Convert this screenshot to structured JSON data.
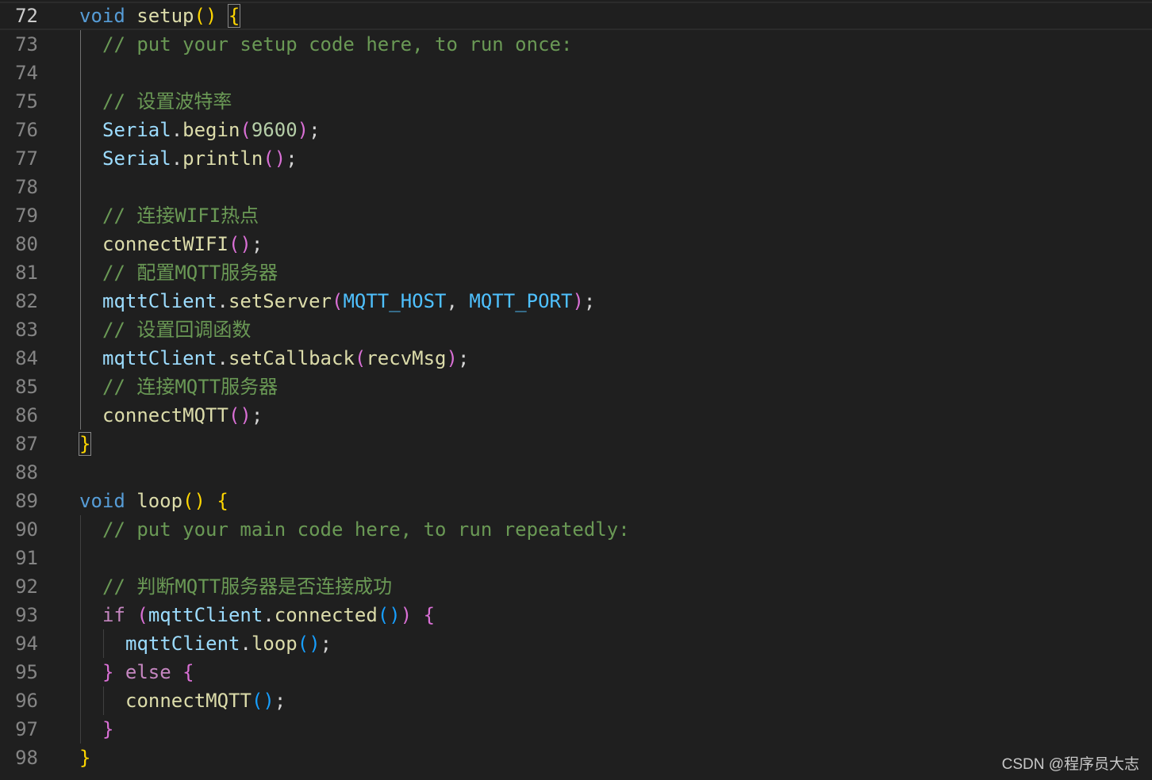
{
  "editor": {
    "language": "cpp",
    "theme_colors": {
      "background": "#1f1f1f",
      "line_number": "#858585",
      "keyword": "#569cd6",
      "control": "#c586c0",
      "function": "#dcdcaa",
      "variable": "#9cdcfe",
      "constant": "#4fc1ff",
      "number": "#b5cea8",
      "comment": "#6a9955",
      "bracket_level_1": "#ffd700",
      "bracket_level_2": "#da70d6",
      "bracket_level_3": "#179fff"
    },
    "current_line": 72,
    "lines": [
      {
        "n": "72",
        "indent": 0,
        "tokens": [
          [
            "kw",
            "void"
          ],
          [
            "punc",
            " "
          ],
          [
            "fn",
            "setup"
          ],
          [
            "b1",
            "()"
          ],
          [
            "punc",
            " "
          ],
          [
            "b1m",
            "{"
          ]
        ]
      },
      {
        "n": "73",
        "indent": 1,
        "tokens": [
          [
            "cmt",
            "// put your setup code here, to run once:"
          ]
        ]
      },
      {
        "n": "74",
        "indent": 1,
        "tokens": []
      },
      {
        "n": "75",
        "indent": 1,
        "tokens": [
          [
            "cmt",
            "// 设置波特率"
          ]
        ]
      },
      {
        "n": "76",
        "indent": 1,
        "tokens": [
          [
            "var",
            "Serial"
          ],
          [
            "punc",
            "."
          ],
          [
            "fn",
            "begin"
          ],
          [
            "b2",
            "("
          ],
          [
            "num",
            "9600"
          ],
          [
            "b2",
            ")"
          ],
          [
            "punc",
            ";"
          ]
        ]
      },
      {
        "n": "77",
        "indent": 1,
        "tokens": [
          [
            "var",
            "Serial"
          ],
          [
            "punc",
            "."
          ],
          [
            "fn",
            "println"
          ],
          [
            "b2",
            "()"
          ],
          [
            "punc",
            ";"
          ]
        ]
      },
      {
        "n": "78",
        "indent": 1,
        "tokens": []
      },
      {
        "n": "79",
        "indent": 1,
        "tokens": [
          [
            "cmt",
            "// 连接WIFI热点"
          ]
        ]
      },
      {
        "n": "80",
        "indent": 1,
        "tokens": [
          [
            "fn",
            "connectWIFI"
          ],
          [
            "b2",
            "()"
          ],
          [
            "punc",
            ";"
          ]
        ]
      },
      {
        "n": "81",
        "indent": 1,
        "tokens": [
          [
            "cmt",
            "// 配置MQTT服务器"
          ]
        ]
      },
      {
        "n": "82",
        "indent": 1,
        "tokens": [
          [
            "var",
            "mqttClient"
          ],
          [
            "punc",
            "."
          ],
          [
            "fn",
            "setServer"
          ],
          [
            "b2",
            "("
          ],
          [
            "const",
            "MQTT_HOST"
          ],
          [
            "punc",
            ", "
          ],
          [
            "const",
            "MQTT_PORT"
          ],
          [
            "b2",
            ")"
          ],
          [
            "punc",
            ";"
          ]
        ]
      },
      {
        "n": "83",
        "indent": 1,
        "tokens": [
          [
            "cmt",
            "// 设置回调函数"
          ]
        ]
      },
      {
        "n": "84",
        "indent": 1,
        "tokens": [
          [
            "var",
            "mqttClient"
          ],
          [
            "punc",
            "."
          ],
          [
            "fn",
            "setCallback"
          ],
          [
            "b2",
            "("
          ],
          [
            "fn",
            "recvMsg"
          ],
          [
            "b2",
            ")"
          ],
          [
            "punc",
            ";"
          ]
        ]
      },
      {
        "n": "85",
        "indent": 1,
        "tokens": [
          [
            "cmt",
            "// 连接MQTT服务器"
          ]
        ]
      },
      {
        "n": "86",
        "indent": 1,
        "tokens": [
          [
            "fn",
            "connectMQTT"
          ],
          [
            "b2",
            "()"
          ],
          [
            "punc",
            ";"
          ]
        ]
      },
      {
        "n": "87",
        "indent": 0,
        "tokens": [
          [
            "b1m",
            "}"
          ]
        ]
      },
      {
        "n": "88",
        "indent": 0,
        "tokens": []
      },
      {
        "n": "89",
        "indent": 0,
        "tokens": [
          [
            "kw",
            "void"
          ],
          [
            "punc",
            " "
          ],
          [
            "fn",
            "loop"
          ],
          [
            "b1",
            "()"
          ],
          [
            "punc",
            " "
          ],
          [
            "b1",
            "{"
          ]
        ]
      },
      {
        "n": "90",
        "indent": 1,
        "tokens": [
          [
            "cmt",
            "// put your main code here, to run repeatedly:"
          ]
        ]
      },
      {
        "n": "91",
        "indent": 1,
        "tokens": []
      },
      {
        "n": "92",
        "indent": 1,
        "tokens": [
          [
            "cmt",
            "// 判断MQTT服务器是否连接成功"
          ]
        ]
      },
      {
        "n": "93",
        "indent": 1,
        "tokens": [
          [
            "ctrl",
            "if"
          ],
          [
            "punc",
            " "
          ],
          [
            "b2",
            "("
          ],
          [
            "var",
            "mqttClient"
          ],
          [
            "punc",
            "."
          ],
          [
            "fn",
            "connected"
          ],
          [
            "b3",
            "()"
          ],
          [
            "b2",
            ")"
          ],
          [
            "punc",
            " "
          ],
          [
            "b2",
            "{"
          ]
        ]
      },
      {
        "n": "94",
        "indent": 2,
        "tokens": [
          [
            "var",
            "mqttClient"
          ],
          [
            "punc",
            "."
          ],
          [
            "fn",
            "loop"
          ],
          [
            "b3",
            "()"
          ],
          [
            "punc",
            ";"
          ]
        ]
      },
      {
        "n": "95",
        "indent": 1,
        "tokens": [
          [
            "b2",
            "}"
          ],
          [
            "punc",
            " "
          ],
          [
            "ctrl",
            "else"
          ],
          [
            "punc",
            " "
          ],
          [
            "b2",
            "{"
          ]
        ]
      },
      {
        "n": "96",
        "indent": 2,
        "tokens": [
          [
            "fn",
            "connectMQTT"
          ],
          [
            "b3",
            "()"
          ],
          [
            "punc",
            ";"
          ]
        ]
      },
      {
        "n": "97",
        "indent": 1,
        "tokens": [
          [
            "b2",
            "}"
          ]
        ]
      },
      {
        "n": "98",
        "indent": 0,
        "tokens": [
          [
            "b1",
            "}"
          ]
        ]
      }
    ]
  },
  "watermark": "CSDN @程序员大志"
}
